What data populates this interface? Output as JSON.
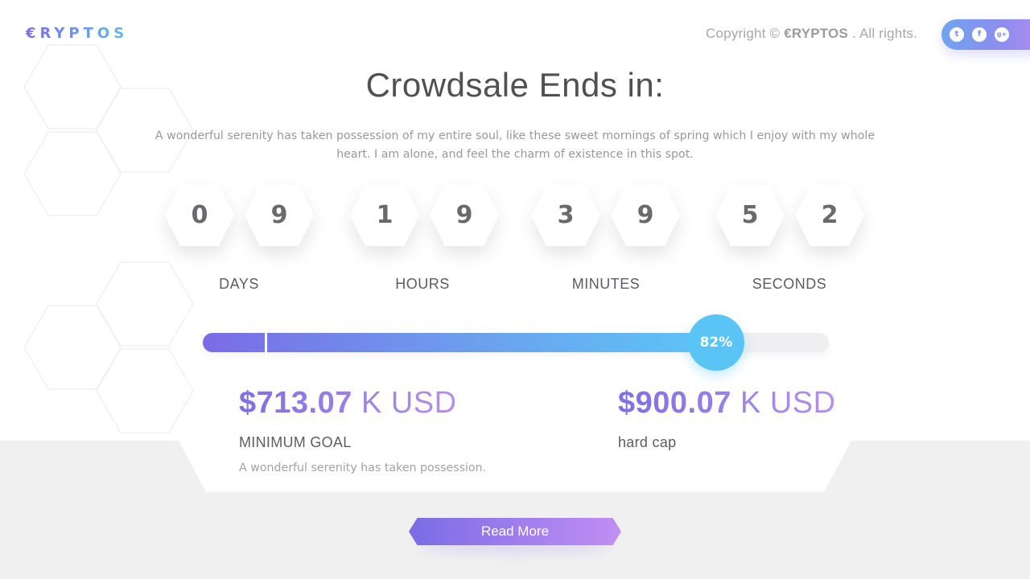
{
  "brand": {
    "logo_text": "€RYPTOS"
  },
  "header": {
    "copyright_prefix": "Copyright ©",
    "copyright_brand": "€RYPTOS",
    "copyright_suffix": ". All rights.",
    "social": [
      {
        "name": "twitter",
        "glyph": "t"
      },
      {
        "name": "facebook",
        "glyph": "f"
      },
      {
        "name": "google-plus",
        "glyph": "g+"
      }
    ]
  },
  "countdown": {
    "title": "Crowdsale Ends in:",
    "description": "A wonderful serenity has taken possession of my entire soul, like these sweet mornings of spring which I enjoy with my whole heart. I am alone, and feel the charm of existence in this spot.",
    "units": [
      {
        "label": "DAYS",
        "digits": [
          "0",
          "9"
        ]
      },
      {
        "label": "HOURS",
        "digits": [
          "1",
          "9"
        ]
      },
      {
        "label": "MINUTES",
        "digits": [
          "3",
          "9"
        ]
      },
      {
        "label": "SECONDS",
        "digits": [
          "5",
          "2"
        ]
      }
    ]
  },
  "progress": {
    "percent": 82,
    "label": "82%"
  },
  "goals": {
    "minimum": {
      "amount": "$713.07",
      "unit": "K USD",
      "label": "MINIMUM GOAL",
      "description": "A wonderful serenity has taken possession."
    },
    "hardcap": {
      "amount": "$900.07",
      "unit": "K USD",
      "label": "hard cap"
    }
  },
  "cta": {
    "label": "Read More"
  },
  "colors": {
    "accent_start": "#7a6ce6",
    "accent_end": "#5cc6f6",
    "button_end": "#c28ff2"
  }
}
